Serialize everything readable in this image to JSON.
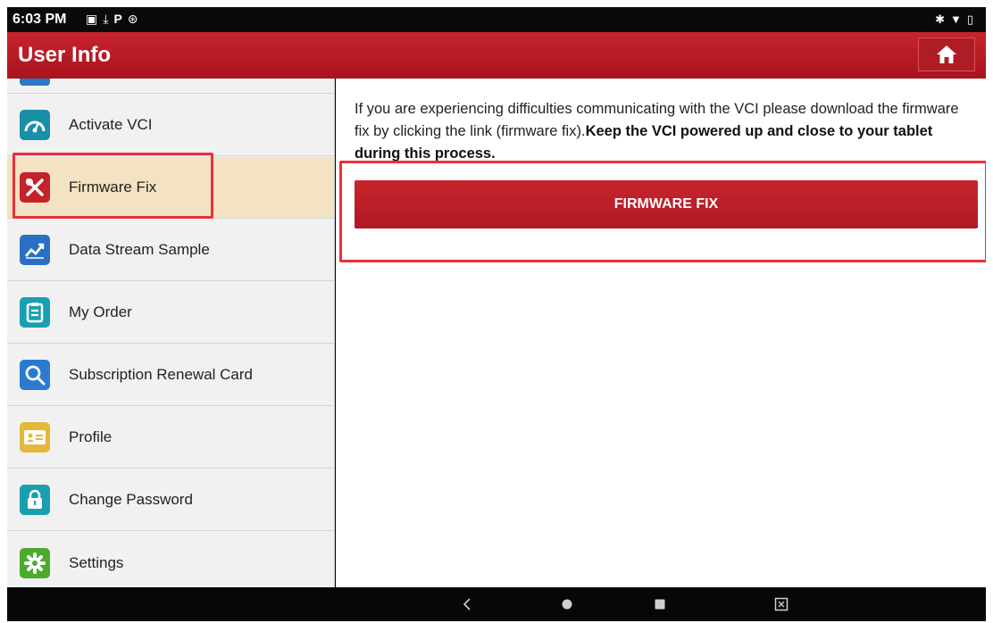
{
  "status_bar": {
    "time": "6:03 PM",
    "notification_icons": [
      "image-icon",
      "download-icon",
      "p-icon",
      "settings-badge-icon"
    ],
    "system_icons": [
      "bluetooth-icon",
      "wifi-icon",
      "battery-icon"
    ]
  },
  "header": {
    "title": "User Info",
    "home_icon": "home-icon"
  },
  "sidebar": {
    "items": [
      {
        "label": "Activate VCI",
        "icon": "gauge-icon",
        "color": "#1a8fa8",
        "active": false
      },
      {
        "label": "Firmware Fix",
        "icon": "tools-icon",
        "color": "#c4232c",
        "active": true
      },
      {
        "label": "Data Stream Sample",
        "icon": "chart-trend-icon",
        "color": "#2b6fc4",
        "active": false
      },
      {
        "label": "My Order",
        "icon": "clipboard-icon",
        "color": "#1a9fb0",
        "active": false
      },
      {
        "label": "Subscription Renewal Card",
        "icon": "search-icon",
        "color": "#2a7bd0",
        "active": false
      },
      {
        "label": "Profile",
        "icon": "id-card-icon",
        "color": "#e6b83a",
        "active": false
      },
      {
        "label": "Change Password",
        "icon": "lock-icon",
        "color": "#1a9fb0",
        "active": false
      },
      {
        "label": "Settings",
        "icon": "gear-icon",
        "color": "#4caa2c",
        "active": false
      }
    ]
  },
  "main": {
    "description_plain": "If you are experiencing difficulties communicating with the VCI please download the firmware fix by clicking the link (firmware fix).",
    "description_bold": "Keep the VCI powered up and close to your tablet during this process.",
    "button_label": "FIRMWARE FIX"
  },
  "nav_bar": {
    "buttons": [
      "back-icon",
      "home-circle-icon",
      "recents-icon",
      "screenshot-icon"
    ]
  },
  "colors": {
    "brand_red": "#b81c25",
    "active_row": "#f3e3c2",
    "highlight_box": "#e8303a"
  }
}
